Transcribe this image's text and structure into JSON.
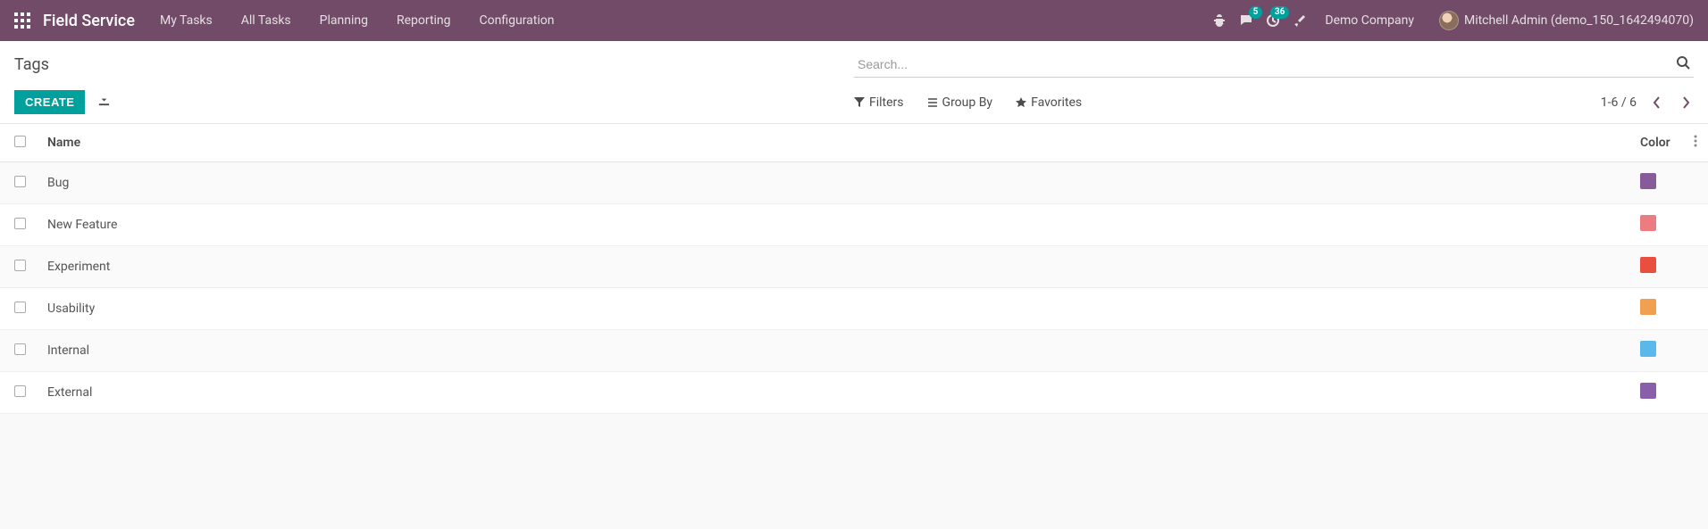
{
  "topbar": {
    "app_name": "Field Service",
    "nav": [
      "My Tasks",
      "All Tasks",
      "Planning",
      "Reporting",
      "Configuration"
    ],
    "messages_badge": "5",
    "activities_badge": "36",
    "company": "Demo Company",
    "user": "Mitchell Admin (demo_150_1642494070)"
  },
  "control": {
    "breadcrumb": "Tags",
    "search_placeholder": "Search...",
    "create_label": "Create",
    "filters_label": "Filters",
    "groupby_label": "Group By",
    "favorites_label": "Favorites",
    "pager": "1-6 / 6"
  },
  "table": {
    "headers": {
      "name": "Name",
      "color": "Color"
    },
    "rows": [
      {
        "name": "Bug",
        "color": "#875a9b"
      },
      {
        "name": "New Feature",
        "color": "#eb7c7f"
      },
      {
        "name": "Experiment",
        "color": "#e94f3f"
      },
      {
        "name": "Usability",
        "color": "#f0a04f"
      },
      {
        "name": "Internal",
        "color": "#5bb8eb"
      },
      {
        "name": "External",
        "color": "#8a5fa9"
      }
    ]
  }
}
